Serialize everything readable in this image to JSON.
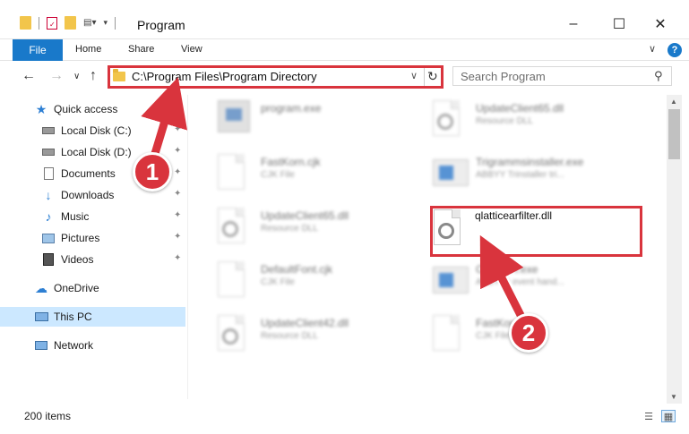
{
  "window": {
    "title": "Program",
    "minimize": "–",
    "maximize": "☐",
    "close": "✕"
  },
  "ribbon": {
    "file": "File",
    "tabs": [
      "Home",
      "Share",
      "View"
    ],
    "expand": "∨",
    "help": "?"
  },
  "nav": {
    "back": "←",
    "forward": "→",
    "recent": "∨",
    "up": "↑",
    "address": "C:\\Program Files\\Program Directory",
    "address_dropdown": "∨",
    "refresh": "↻",
    "search_placeholder": "Search Program",
    "search_icon": "⚲"
  },
  "sidebar": {
    "items": [
      {
        "label": "Quick access",
        "icon": "star-icon",
        "color": "#2d7fd3"
      },
      {
        "label": "Local Disk (C:)",
        "icon": "drive-icon",
        "pinned": true
      },
      {
        "label": "Local Disk (D:)",
        "icon": "drive-icon",
        "pinned": true
      },
      {
        "label": "Documents",
        "icon": "documents-icon",
        "pinned": true
      },
      {
        "label": "Downloads",
        "icon": "downloads-icon",
        "pinned": true
      },
      {
        "label": "Music",
        "icon": "music-icon",
        "pinned": true
      },
      {
        "label": "Pictures",
        "icon": "pictures-icon",
        "pinned": true
      },
      {
        "label": "Videos",
        "icon": "videos-icon",
        "pinned": true
      },
      {
        "label": "OneDrive",
        "icon": "onedrive-icon"
      },
      {
        "label": "This PC",
        "icon": "this-pc-icon",
        "selected": true
      },
      {
        "label": "Network",
        "icon": "network-icon"
      }
    ],
    "pin_glyph": "📌"
  },
  "files": [
    {
      "name": "program.exe",
      "type": "",
      "icon": "exe"
    },
    {
      "name": "UpdateClient65.dll",
      "type": "Resource DLL",
      "icon": "gear"
    },
    {
      "name": "FastKorn.cjk",
      "type": "CJK File",
      "icon": "doc"
    },
    {
      "name": "Trigrammsinstaller.exe",
      "type": "ABBYY Trinstaller tri...",
      "icon": "app"
    },
    {
      "name": "UpdateClient65.dll",
      "type": "Resource DLL",
      "icon": "gear"
    },
    {
      "name": "DefaultFont.cjk",
      "type": "CJK File",
      "icon": "doc"
    },
    {
      "name": "CopySTI.exe",
      "type": "ABBY dr event hand...",
      "icon": "app"
    },
    {
      "name": "UpdateClient42.dll",
      "type": "Resource DLL",
      "icon": "gear"
    },
    {
      "name": "FastKorn",
      "type": "CJK File",
      "icon": "doc"
    }
  ],
  "focus_file": {
    "name": "qlatticearfilter.dll"
  },
  "callouts": [
    "1",
    "2"
  ],
  "status": {
    "items": "200 items"
  },
  "colors": {
    "accent": "#1979ca",
    "highlight": "#d9343d",
    "selected": "#cce8ff"
  }
}
